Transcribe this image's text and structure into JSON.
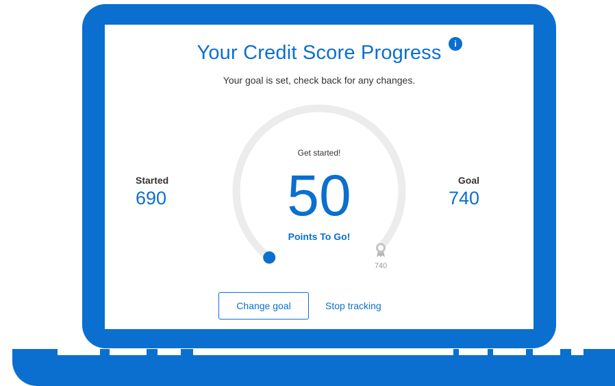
{
  "header": {
    "title": "Your Credit Score Progress",
    "info_icon": "info-icon",
    "info_glyph": "i",
    "subtitle": "Your goal is set, check back for any changes."
  },
  "started": {
    "label": "Started",
    "value": "690"
  },
  "goal": {
    "label": "Goal",
    "value": "740"
  },
  "progress": {
    "status": "Get started!",
    "points_remaining": "50",
    "points_label": "Points To Go!",
    "fraction_complete": 0,
    "goal_marker_icon": "award-ribbon-icon",
    "goal_marker_value": "740"
  },
  "actions": {
    "change_goal": "Change goal",
    "stop_tracking": "Stop tracking"
  },
  "colors": {
    "accent": "#0b6fcf",
    "track": "#ececec",
    "text": "#333333",
    "muted": "#999999"
  }
}
